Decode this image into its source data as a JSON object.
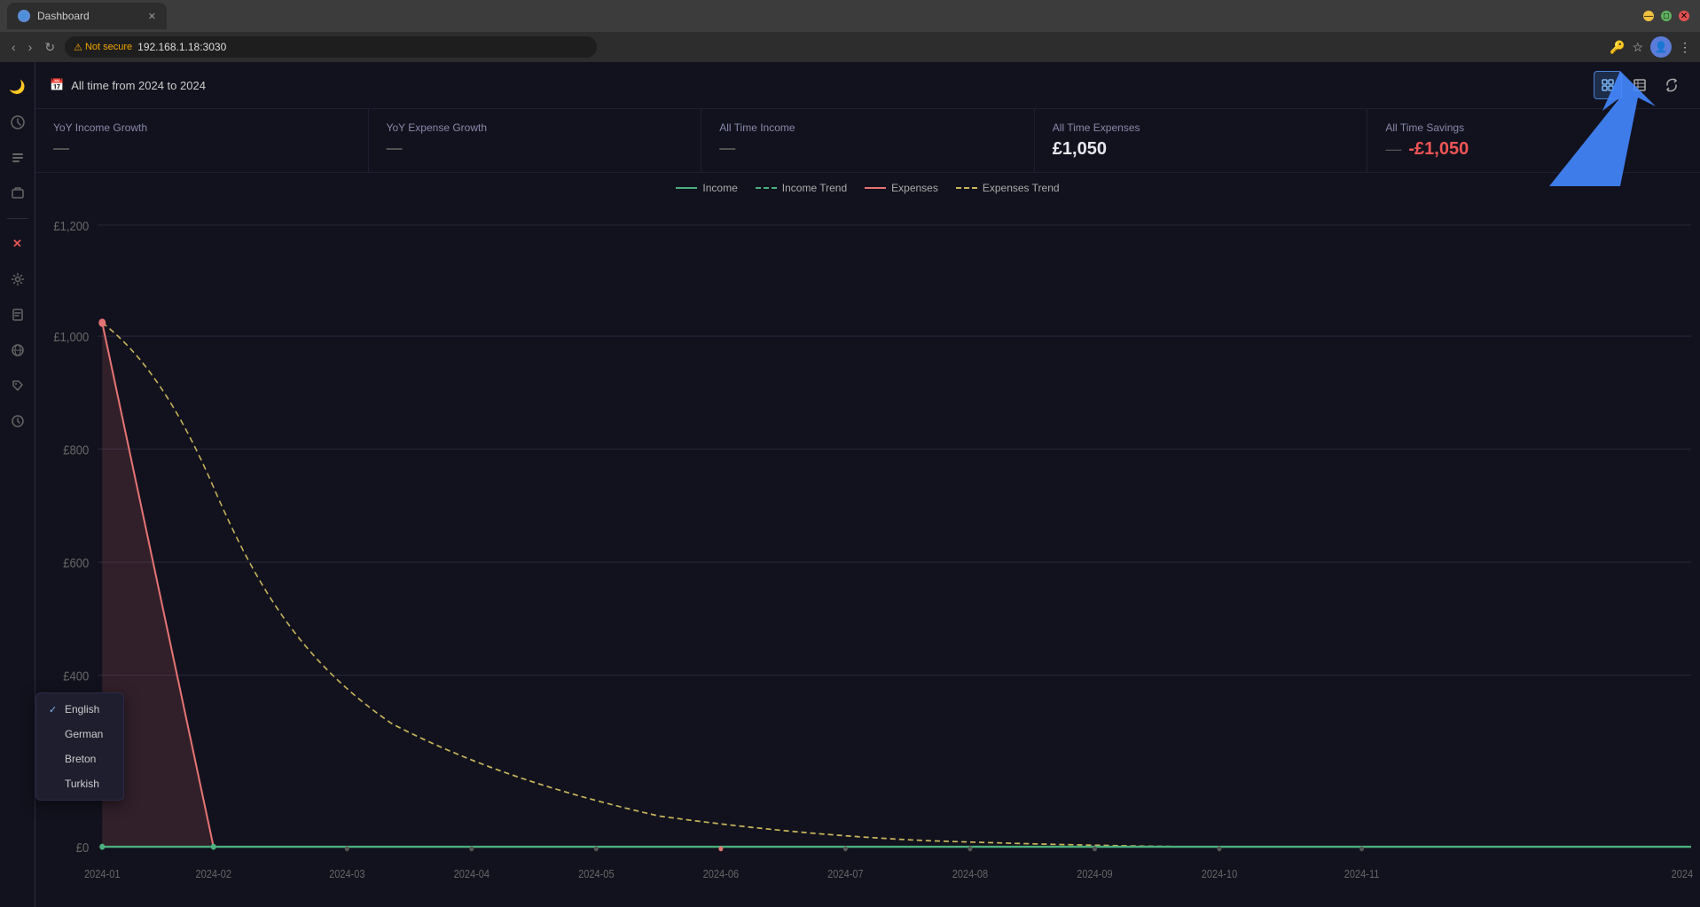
{
  "browser": {
    "tab_title": "Dashboard",
    "tab_favicon": "●",
    "address": "192.168.1.18:3030",
    "not_secure_label": "Not secure",
    "window_title": "Dashboard"
  },
  "header": {
    "date_range": "All time from 2024 to 2024",
    "calendar_icon": "📅",
    "btn_grid": "⊞",
    "btn_table": "⊟",
    "btn_refresh": "↻"
  },
  "stats": [
    {
      "label": "YoY Income Growth",
      "value": "—",
      "sub": ""
    },
    {
      "label": "YoY Expense Growth",
      "value": "—",
      "sub": ""
    },
    {
      "label": "All Time Income",
      "value": "—",
      "sub": ""
    },
    {
      "label": "All Time Expenses",
      "value": "£1,050",
      "sub": ""
    },
    {
      "label": "All Time Savings",
      "value": "-£1,050",
      "sub": "—",
      "negative": true
    }
  ],
  "chart": {
    "legend": [
      {
        "id": "income",
        "label": "Income",
        "style": "solid-green"
      },
      {
        "id": "income-trend",
        "label": "Income Trend",
        "style": "dashed-green"
      },
      {
        "id": "expenses",
        "label": "Expenses",
        "style": "solid-red"
      },
      {
        "id": "expenses-trend",
        "label": "Expenses Trend",
        "style": "dashed-yellow"
      }
    ],
    "y_labels": [
      "£1,200",
      "£1,000",
      "£800",
      "£600",
      "£400",
      "£0"
    ],
    "x_labels": [
      "2024-01",
      "2024-02",
      "2024-03",
      "2024-04",
      "2024-05",
      "2024-06",
      "2024-07",
      "2024-08",
      "2024-09",
      "2024-10",
      "2024-11",
      "2024"
    ],
    "y_values": [
      1200,
      1000,
      800,
      600,
      400,
      0
    ]
  },
  "sidebar": {
    "items": [
      {
        "icon": "◑",
        "name": "theme-toggle",
        "active": true
      },
      {
        "icon": "○",
        "name": "dashboard"
      },
      {
        "icon": "⊕",
        "name": "add"
      },
      {
        "icon": "⬡",
        "name": "accounts"
      },
      {
        "icon": "✕",
        "name": "close-x",
        "special": "x"
      },
      {
        "icon": "⊙",
        "name": "settings"
      },
      {
        "icon": "▤",
        "name": "reports"
      },
      {
        "icon": "⊕",
        "name": "add2"
      },
      {
        "icon": "⊛",
        "name": "misc"
      },
      {
        "icon": "◷",
        "name": "time"
      }
    ]
  },
  "language_menu": {
    "items": [
      {
        "label": "English",
        "selected": true
      },
      {
        "label": "German",
        "selected": false
      },
      {
        "label": "Breton",
        "selected": false
      },
      {
        "label": "Turkish",
        "selected": false
      }
    ]
  }
}
